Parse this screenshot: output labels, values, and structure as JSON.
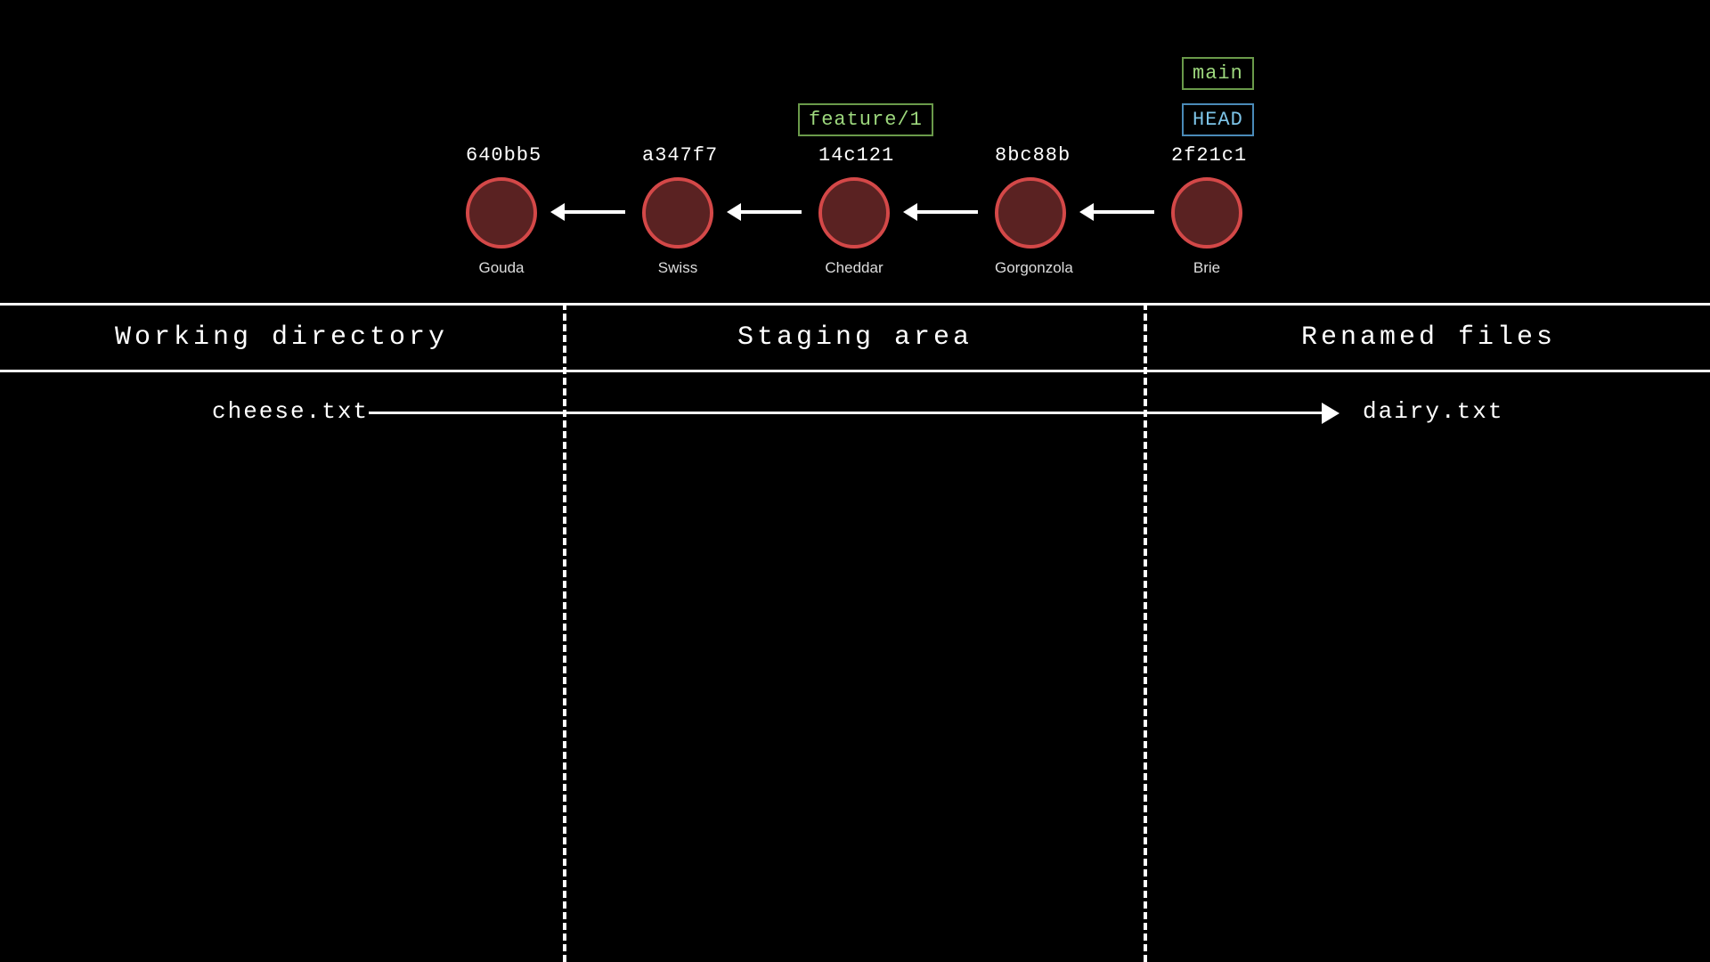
{
  "refs": {
    "main": "main",
    "head": "HEAD",
    "feature": "feature/1"
  },
  "commits": [
    {
      "hash": "640bb5",
      "msg": "Gouda"
    },
    {
      "hash": "a347f7",
      "msg": "Swiss"
    },
    {
      "hash": "14c121",
      "msg": "Cheddar"
    },
    {
      "hash": "8bc88b",
      "msg": "Gorgonzola"
    },
    {
      "hash": "2f21c1",
      "msg": "Brie"
    }
  ],
  "sections": {
    "working": "Working directory",
    "staging": "Staging area",
    "renamed": "Renamed files"
  },
  "files": {
    "source": "cheese.txt",
    "target": "dairy.txt"
  }
}
